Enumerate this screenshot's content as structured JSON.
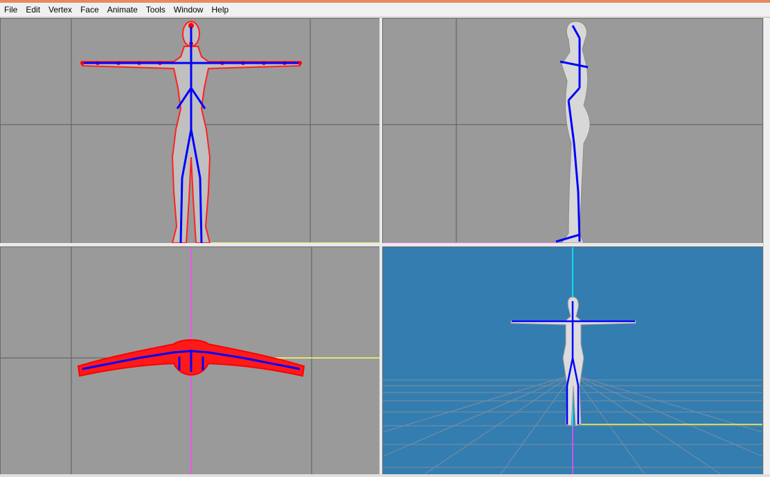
{
  "window": {
    "title_bar_color": "#e98a5c"
  },
  "menu": {
    "items": [
      "File",
      "Edit",
      "Vertex",
      "Face",
      "Animate",
      "Tools",
      "Window",
      "Help"
    ]
  },
  "viewports": {
    "front": {
      "view": "front",
      "background": "#9a9a9a",
      "mesh_color": "#ff0000",
      "skeleton_color": "#0000ff"
    },
    "side": {
      "view": "side",
      "background": "#9a9a9a",
      "model_color": "#d8d8d8",
      "skeleton_color": "#0000ff"
    },
    "top": {
      "view": "top",
      "background": "#9a9a9a",
      "mesh_color": "#ff0000",
      "skeleton_color": "#0000ff"
    },
    "perspective": {
      "view": "3d",
      "background": "#347db0",
      "grid_color": "#8a8a8a",
      "axis_colors": [
        "#00ffff",
        "#ffff00",
        "#ff00ff"
      ]
    }
  }
}
